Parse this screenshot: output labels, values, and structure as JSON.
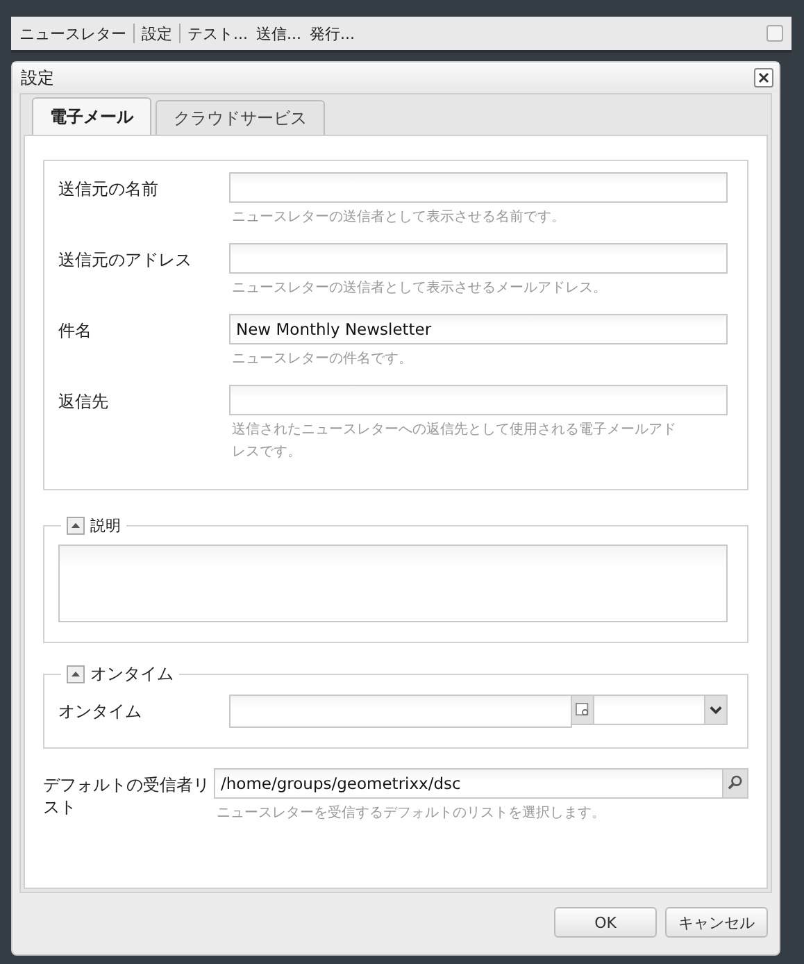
{
  "toolbar": {
    "groups": [
      [
        "ニュースレター"
      ],
      [
        "設定"
      ],
      [
        "テスト...",
        "送信...",
        "発行..."
      ]
    ],
    "checkbox": {
      "checked": false
    }
  },
  "dialog": {
    "title": "設定",
    "tabs": [
      {
        "label": "電子メール",
        "selected": true
      },
      {
        "label": "クラウドサービス",
        "selected": false
      }
    ],
    "email_fields": [
      {
        "label": "送信元の名前",
        "help": "ニュースレターの送信者として表示させる名前です。"
      },
      {
        "label": "送信元のアドレス",
        "help": "ニュースレターの送信者として表示させるメールアドレス。"
      },
      {
        "label": "件名",
        "value": "New Monthly Newsletter",
        "help": "ニュースレターの件名です。"
      },
      {
        "label": "返信先",
        "help": "送信されたニュースレターへの返信先として使用される電子メールアドレスです。"
      }
    ],
    "description": {
      "legend": "説明",
      "expanded": true
    },
    "ontime": {
      "legend": "オンタイム",
      "expanded": true,
      "field": {
        "label": "オンタイム"
      }
    },
    "recipient_list": {
      "label": "デフォルトの受信者リスト",
      "value": "/home/groups/geometrixx/dsc",
      "help": "ニュースレターを受信するデフォルトのリストを選択します。"
    }
  },
  "buttons": [
    "OK",
    "キャンセル"
  ]
}
